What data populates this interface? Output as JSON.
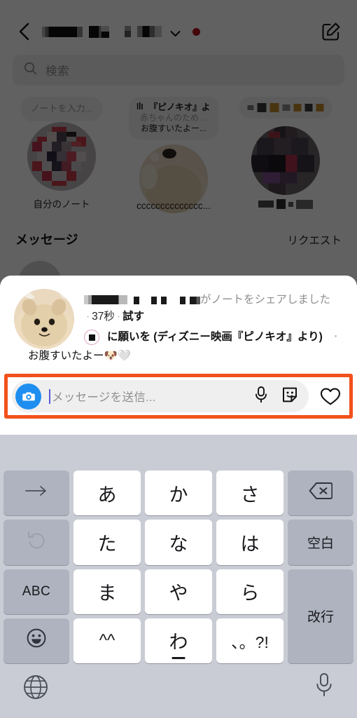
{
  "app": {
    "name": "Instagram Direct"
  },
  "header": {
    "back_icon": "chevron-left-icon",
    "username_redacted": "[redacted username]",
    "dropdown_icon": "chevron-down-icon",
    "unread_dot_color": "#b4121b",
    "compose_icon": "compose-new-message-icon"
  },
  "search": {
    "icon": "search-icon",
    "placeholder": "検索",
    "value": ""
  },
  "notes": {
    "items": [
      {
        "bubble_placeholder": "ノートを入力...",
        "label": "自分のノート",
        "avatar": "own-avatar-redacted",
        "label_redacted": false
      },
      {
        "bubble_line1": "『ピノキオ』よ",
        "bubble_line2": "赤ちゃんのため…",
        "bubble_line3": "お腹すいたよー...",
        "bubble_icon": "music-note-icon",
        "label": "cccccccccccccc...",
        "avatar": "pomeranian-dog-avatar",
        "label_redacted": false
      },
      {
        "bubble_placeholder": "",
        "label": "[redacted username]",
        "avatar": "redacted-avatar",
        "label_redacted": true
      }
    ]
  },
  "messages_header": {
    "title": "メッセージ",
    "requests_label": "リクエスト"
  },
  "note_sheet": {
    "avatar": "pomeranian-dog-avatar",
    "sender_redacted": "[redacted username]",
    "action_text": "がノートをシェアしました",
    "separator": "·",
    "timestamp": "37秒",
    "try_label": "試す",
    "music_icon": "music-disc-icon",
    "note_text": "に願いを (ディズニー映画『ピノキオ』より)",
    "note_text_truncated": "・ ",
    "note_text_line2": "お腹すいたよー🐶🤍"
  },
  "input_bar": {
    "camera_icon": "camera-icon",
    "camera_color": "#1e8ff0",
    "placeholder": "メッセージを送信...",
    "value": "",
    "cursor_visible": true,
    "mic_icon": "microphone-icon",
    "sticker_icon": "sticker-icon",
    "heart_icon": "heart-icon",
    "highlight_color": "#f2511b"
  },
  "keyboard": {
    "type": "japanese-kana-12key",
    "rows": [
      [
        {
          "label": "→",
          "name": "cursor-right-key",
          "style": "gray",
          "icon": "arrow-right-icon"
        },
        {
          "label": "あ",
          "name": "kana-a-key",
          "style": "white"
        },
        {
          "label": "か",
          "name": "kana-ka-key",
          "style": "white"
        },
        {
          "label": "さ",
          "name": "kana-sa-key",
          "style": "white"
        },
        {
          "label": "⌫",
          "name": "delete-key",
          "style": "gray",
          "icon": "backspace-icon"
        }
      ],
      [
        {
          "label": "↺",
          "name": "undo-key",
          "style": "gray",
          "icon": "undo-icon"
        },
        {
          "label": "た",
          "name": "kana-ta-key",
          "style": "white"
        },
        {
          "label": "な",
          "name": "kana-na-key",
          "style": "white"
        },
        {
          "label": "は",
          "name": "kana-ha-key",
          "style": "white"
        },
        {
          "label": "空白",
          "name": "space-key",
          "style": "gray"
        }
      ],
      [
        {
          "label": "ABC",
          "name": "abc-mode-key",
          "style": "gray"
        },
        {
          "label": "ま",
          "name": "kana-ma-key",
          "style": "white"
        },
        {
          "label": "や",
          "name": "kana-ya-key",
          "style": "white"
        },
        {
          "label": "ら",
          "name": "kana-ra-key",
          "style": "white"
        },
        {
          "label": "改行",
          "name": "return-key",
          "style": "gray",
          "span": 2
        }
      ],
      [
        {
          "label": "☺",
          "name": "emoji-key",
          "style": "gray",
          "icon": "smiley-icon"
        },
        {
          "label": "^^",
          "name": "kaomoji-key",
          "style": "white"
        },
        {
          "label": "わ",
          "name": "kana-wa-key",
          "style": "white"
        },
        {
          "label": "、。?!",
          "name": "punctuation-key",
          "style": "white"
        }
      ]
    ],
    "bottom": {
      "globe_icon": "globe-language-icon",
      "mic_icon": "dictation-microphone-icon"
    }
  }
}
